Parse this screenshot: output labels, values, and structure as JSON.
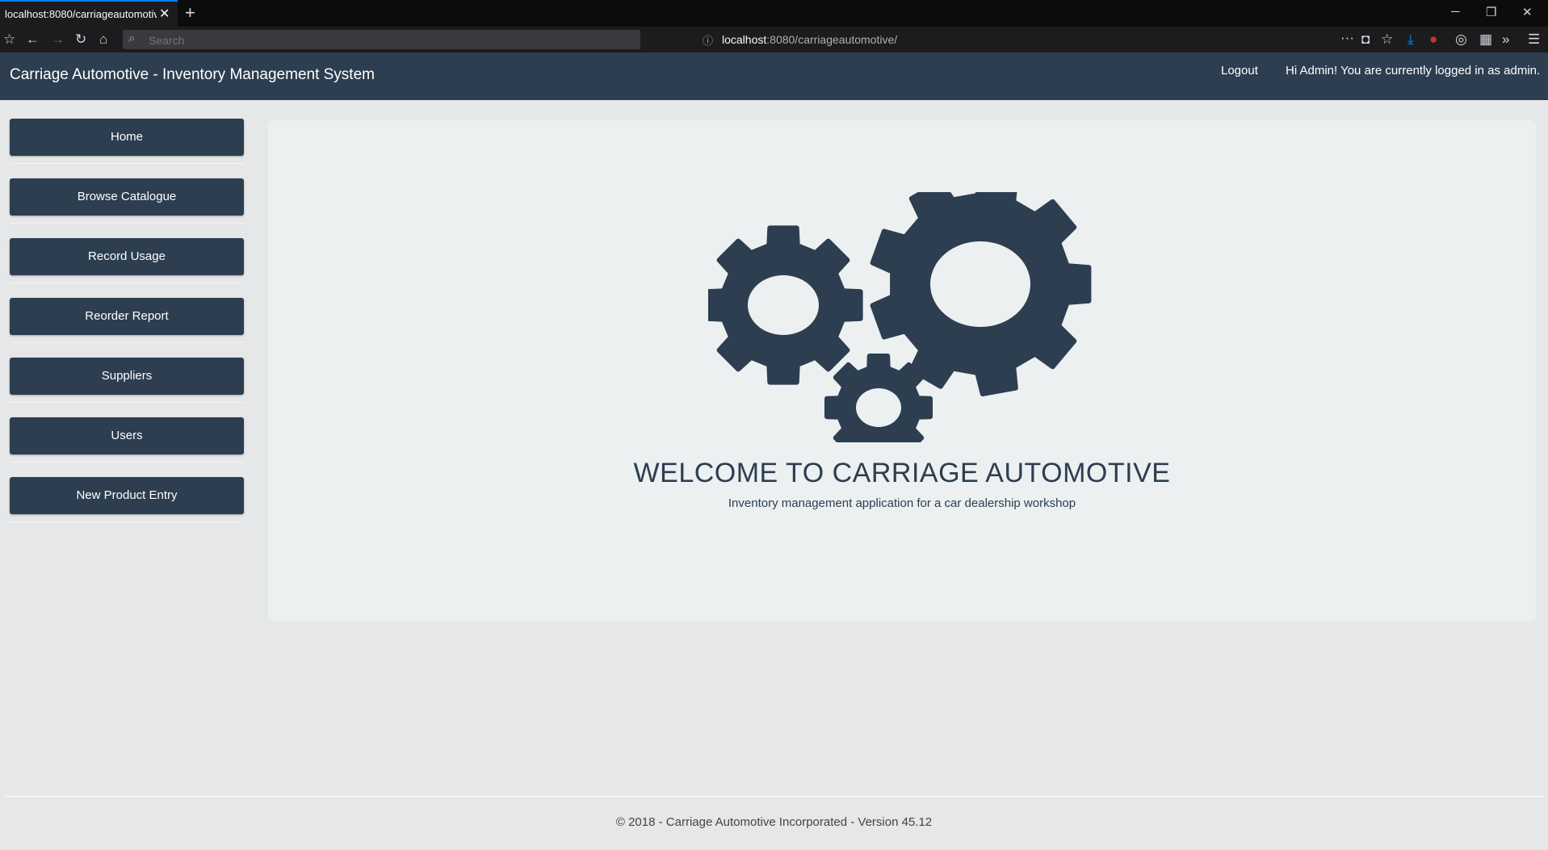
{
  "browser": {
    "tab_title": "localhost:8080/carriageautomotive/",
    "tab_close": "✕",
    "new_tab": "+",
    "search_placeholder": "Search",
    "url_host": "localhost",
    "url_rest": ":8080/carriageautomotive/"
  },
  "header": {
    "brand": "Carriage Automotive - Inventory Management System",
    "logout": "Logout",
    "greeting": "Hi Admin! You are currently logged in as admin."
  },
  "sidebar": {
    "items": [
      {
        "label": "Home"
      },
      {
        "label": "Browse Catalogue"
      },
      {
        "label": "Record Usage"
      },
      {
        "label": "Reorder Report"
      },
      {
        "label": "Suppliers"
      },
      {
        "label": "Users"
      },
      {
        "label": "New Product Entry"
      }
    ]
  },
  "hero": {
    "title": "WELCOME TO CARRIAGE AUTOMOTIVE",
    "subtitle": "Inventory management application for a car dealership workshop",
    "icon": "gears-icon"
  },
  "footer": {
    "text": "© 2018 - Carriage Automotive Incorporated - Version 45.12"
  },
  "colors": {
    "primary": "#2c3e50",
    "hero_bg": "#ecf0f1",
    "page_bg": "#e6e7e8"
  }
}
